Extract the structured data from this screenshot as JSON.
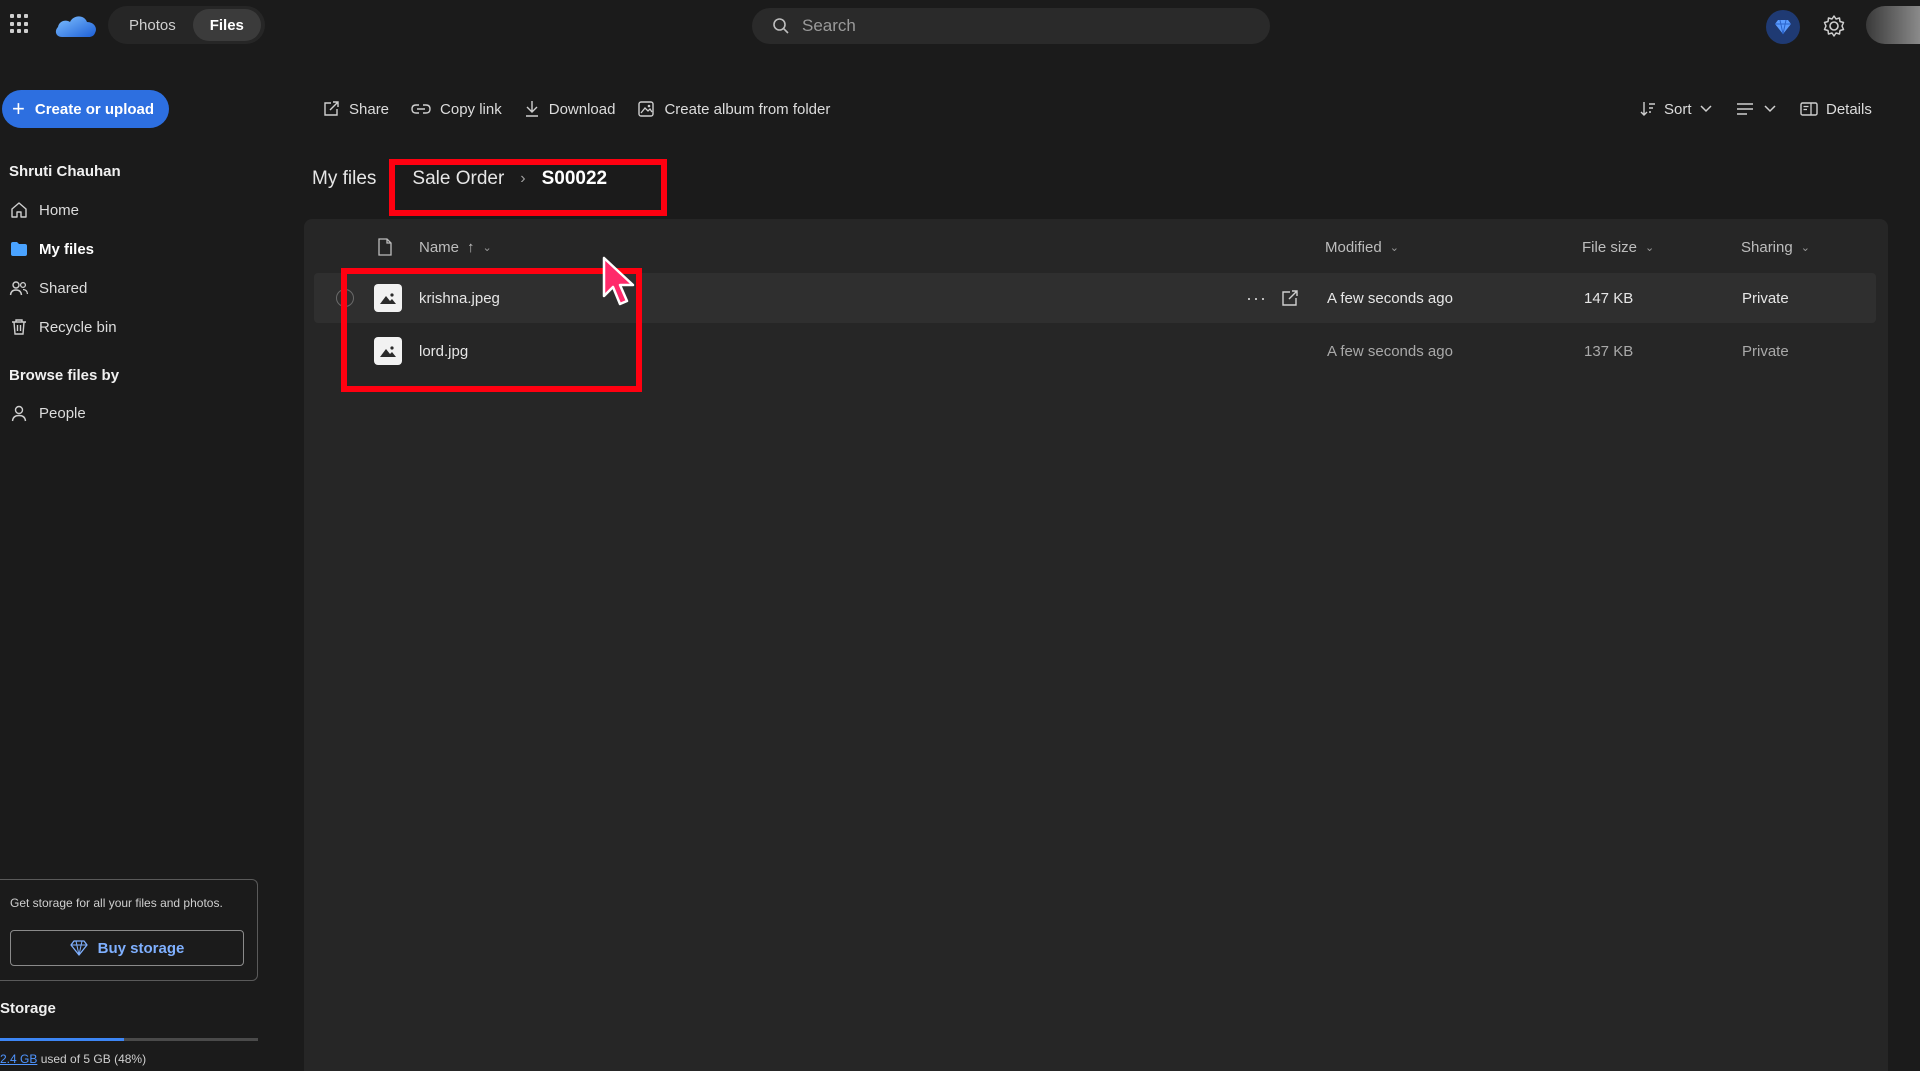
{
  "topbar": {
    "tabs": [
      {
        "label": "Photos",
        "active": false
      },
      {
        "label": "Files",
        "active": true
      }
    ],
    "search_placeholder": "Search"
  },
  "sidebar": {
    "create_label": "Create or upload",
    "user_name": "Shruti Chauhan",
    "nav": [
      {
        "label": "Home",
        "icon": "home-icon"
      },
      {
        "label": "My files",
        "icon": "folder-icon",
        "active": true
      },
      {
        "label": "Shared",
        "icon": "people-icon"
      },
      {
        "label": "Recycle bin",
        "icon": "trash-icon"
      }
    ],
    "browse_label": "Browse files by",
    "browse_nav": [
      {
        "label": "People",
        "icon": "person-icon"
      }
    ],
    "promo_text": "Get storage for all your files and photos.",
    "buy_label": "Buy storage",
    "storage_title": "Storage",
    "storage_used": "2.4 GB",
    "storage_rest": " used of 5 GB (48%)",
    "storage_fraction": 0.48
  },
  "toolbar": {
    "share": "Share",
    "copy_link": "Copy link",
    "download": "Download",
    "create_album": "Create album from folder",
    "sort": "Sort",
    "details": "Details"
  },
  "breadcrumb": {
    "root": "My files",
    "folder": "Sale Order",
    "current": "S00022"
  },
  "columns": {
    "name": "Name",
    "name_sort": "↑",
    "modified": "Modified",
    "file_size": "File size",
    "sharing": "Sharing"
  },
  "files": [
    {
      "name": "krishna.jpeg",
      "modified": "A few seconds ago",
      "size": "147 KB",
      "sharing": "Private"
    },
    {
      "name": "lord.jpg",
      "modified": "A few seconds ago",
      "size": "137 KB",
      "sharing": "Private"
    }
  ],
  "colors": {
    "accent": "#2d6fe0",
    "highlight": "#ff0010",
    "background": "#1b1b1b",
    "panel": "#262626"
  }
}
